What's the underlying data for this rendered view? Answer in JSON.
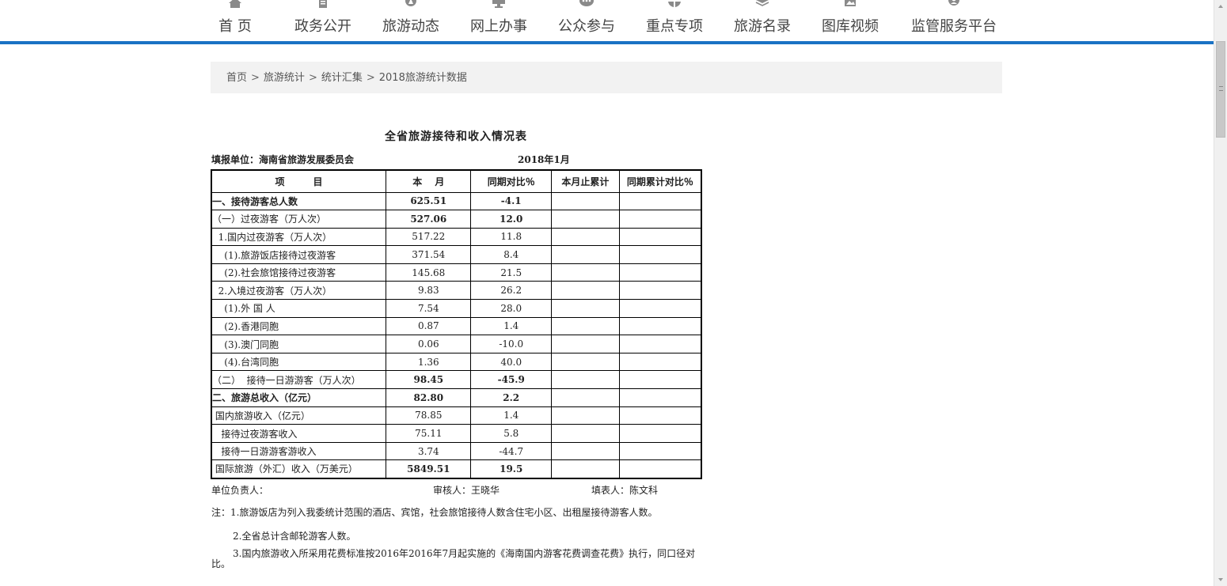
{
  "nav": {
    "items": [
      {
        "label": "首 页",
        "icon": "home-icon"
      },
      {
        "label": "政务公开",
        "icon": "document-icon"
      },
      {
        "label": "旅游动态",
        "icon": "compass-icon"
      },
      {
        "label": "网上办事",
        "icon": "monitor-icon"
      },
      {
        "label": "公众参与",
        "icon": "chat-icon"
      },
      {
        "label": "重点专项",
        "icon": "grid-icon"
      },
      {
        "label": "旅游名录",
        "icon": "layers-icon"
      },
      {
        "label": "图库视频",
        "icon": "image-icon"
      },
      {
        "label": "监管服务平台",
        "icon": "user-icon"
      }
    ],
    "accent": "#1a72c4"
  },
  "breadcrumb": {
    "items": [
      "首页",
      "旅游统计",
      "统计汇集",
      "2018旅游统计数据"
    ],
    "separator": ">"
  },
  "doc": {
    "title": "全省旅游接待和收入情况表",
    "unit": "填报单位：海南省旅游发展委员会",
    "date": "2018年1月",
    "headers": [
      "项　　　目",
      "本　 月",
      "同期对比％",
      "本月止累计",
      "同期累计对比％"
    ],
    "rows": [
      {
        "name": "一、接待游客总人数",
        "month": "625.51",
        "yoy": "-4.1",
        "cum": "",
        "cum_yoy": "",
        "bold": true
      },
      {
        "name": "（一）过夜游客（万人次）",
        "month": "527.06",
        "yoy": "12.0",
        "cum": "",
        "cum_yoy": "",
        "bold": false,
        "bold_values": true
      },
      {
        "name": "  1.国内过夜游客（万人次）",
        "month": "517.22",
        "yoy": "11.8",
        "cum": "",
        "cum_yoy": ""
      },
      {
        "name": "    (1).旅游饭店接待过夜游客",
        "month": "371.54",
        "yoy": "8.4",
        "cum": "",
        "cum_yoy": ""
      },
      {
        "name": "    (2).社会旅馆接待过夜游客",
        "month": "145.68",
        "yoy": "21.5",
        "cum": "",
        "cum_yoy": ""
      },
      {
        "name": "  2.入境过夜游客（万人次）",
        "month": "9.83",
        "yoy": "26.2",
        "cum": "",
        "cum_yoy": ""
      },
      {
        "name": "    (1).外 国 人",
        "month": "7.54",
        "yoy": "28.0",
        "cum": "",
        "cum_yoy": ""
      },
      {
        "name": "    (2).香港同胞",
        "month": "0.87",
        "yoy": "1.4",
        "cum": "",
        "cum_yoy": ""
      },
      {
        "name": "    (3).澳门同胞",
        "month": "0.06",
        "yoy": "-10.0",
        "cum": "",
        "cum_yoy": ""
      },
      {
        "name": "    (4).台湾同胞",
        "month": "1.36",
        "yoy": "40.0",
        "cum": "",
        "cum_yoy": ""
      },
      {
        "name": "（二）  接待一日游游客（万人次）",
        "month": "98.45",
        "yoy": "-45.9",
        "cum": "",
        "cum_yoy": "",
        "bold_values": true
      },
      {
        "name": "二、旅游总收入（亿元）",
        "month": "82.80",
        "yoy": "2.2",
        "cum": "",
        "cum_yoy": "",
        "bold": true
      },
      {
        "name": " 国内旅游收入（亿元）",
        "month": "78.85",
        "yoy": "1.4",
        "cum": "",
        "cum_yoy": ""
      },
      {
        "name": "   接待过夜游客收入",
        "month": "75.11",
        "yoy": "5.8",
        "cum": "",
        "cum_yoy": ""
      },
      {
        "name": "   接待一日游游客游收入",
        "month": "3.74",
        "yoy": "-44.7",
        "cum": "",
        "cum_yoy": ""
      },
      {
        "name": " 国际旅游（外汇）收入（万美元）",
        "month": "5849.51",
        "yoy": "19.5",
        "cum": "",
        "cum_yoy": "",
        "bold_values": true
      }
    ],
    "signers": {
      "responsible": "单位负责人：",
      "reviewer": "审核人：王晓华",
      "filler": "填表人：陈文科"
    },
    "notes": [
      "注：1.旅游饭店为列入我委统计范围的酒店、宾馆，社会旅馆接待人数含住宅小区、出租屋接待游客人数。",
      "2.全省总计含邮轮游客人数。",
      "3.国内旅游收入所采用花费标准按2016年2016年7月起实施的《海南国内游客花费调查花费》执行，同口径对比。"
    ]
  }
}
